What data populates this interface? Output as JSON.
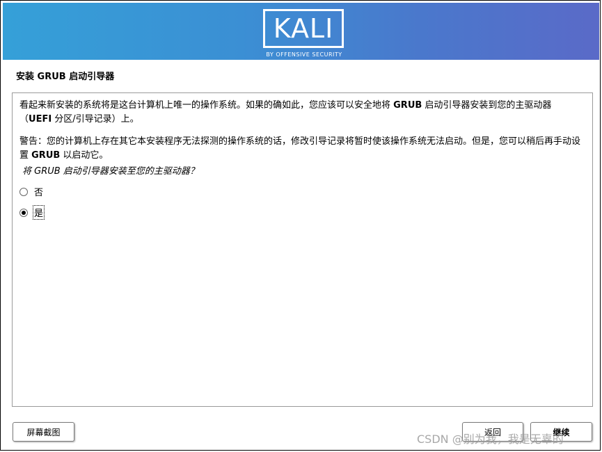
{
  "banner": {
    "logo": "KALI",
    "tagline": "BY OFFENSIVE SECURITY",
    "colors": [
      "#35a0d8",
      "#5a6ac8"
    ]
  },
  "page": {
    "title": "安装 GRUB 启动引导器"
  },
  "content": {
    "paragraph1_a": "看起来新安装的系统将是这台计算机上唯一的操作系统。如果的确如此，您应该可以安全地将 ",
    "paragraph1_b": "GRUB",
    "paragraph1_c": " 启动引导器安装到您的主驱动器（",
    "paragraph1_d": "UEFI",
    "paragraph1_e": " 分区/引导记录）上。",
    "paragraph2_a": "警告：您的计算机上存在其它本安装程序无法探测的操作系统的话，修改引导记录将暂时使该操作系统无法启动。但是，您可以稍后再手动设置 ",
    "paragraph2_b": "GRUB",
    "paragraph2_c": " 以启动它。",
    "question": "将 GRUB 启动引导器安装至您的主驱动器？",
    "options": [
      {
        "label": "否",
        "selected": false
      },
      {
        "label": "是",
        "selected": true
      }
    ]
  },
  "buttons": {
    "screenshot": "屏幕截图",
    "back": "返回",
    "continue": "继续"
  },
  "watermark": "CSDN @别为我，我是无辜的"
}
